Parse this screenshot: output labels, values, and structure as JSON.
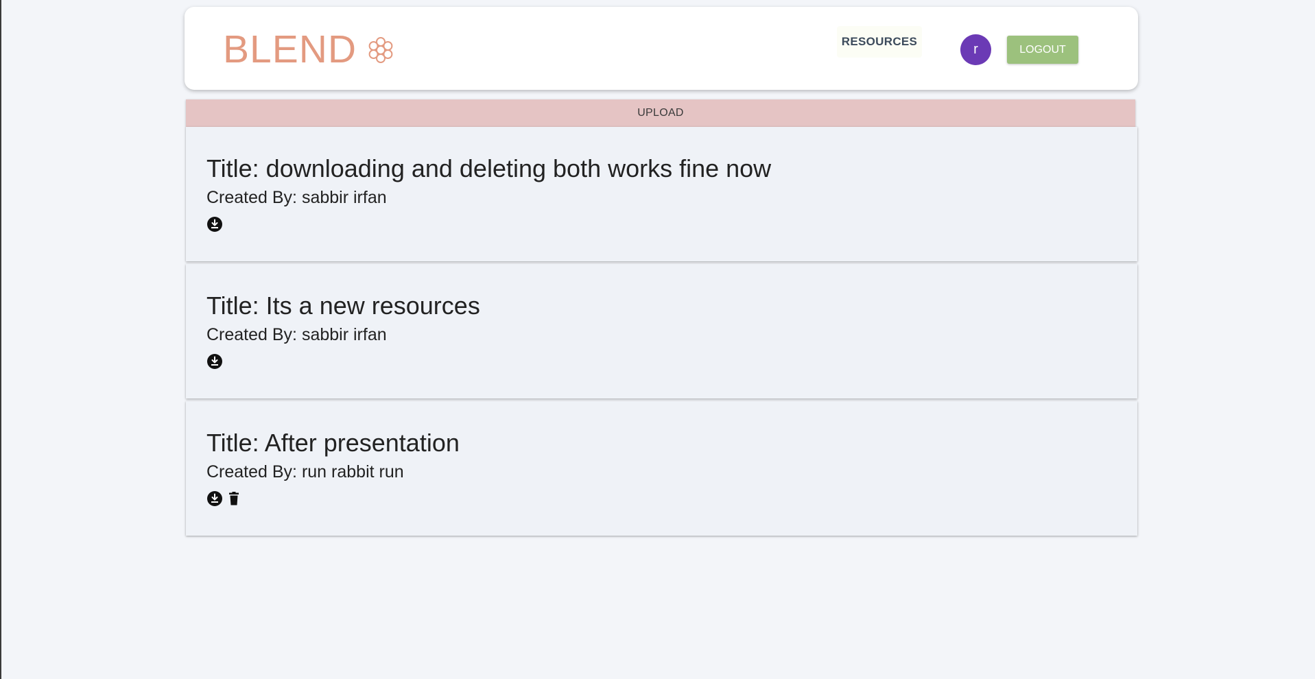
{
  "header": {
    "brand": "BLEND",
    "nav_resources": "RESOURCES",
    "avatar_initial": "r",
    "logout_label": "LOGOUT"
  },
  "upload_label": "UPLOAD",
  "resources": [
    {
      "title": "Title: downloading and deleting both works fine now",
      "author": "Created By: sabbir irfan",
      "actions": [
        "download-icon"
      ]
    },
    {
      "title": "Title: Its a new resources",
      "author": "Created By: sabbir irfan",
      "actions": [
        "download-icon"
      ]
    },
    {
      "title": "Title: After presentation",
      "author": "Created By: run rabbit run",
      "actions": [
        "download-icon",
        "trash-icon"
      ]
    }
  ],
  "colors": {
    "brand": "#e39a80",
    "avatar": "#6b3ab5",
    "logout": "#9cc17d",
    "upload": "#e5c4c4",
    "card": "#eff2f7"
  }
}
